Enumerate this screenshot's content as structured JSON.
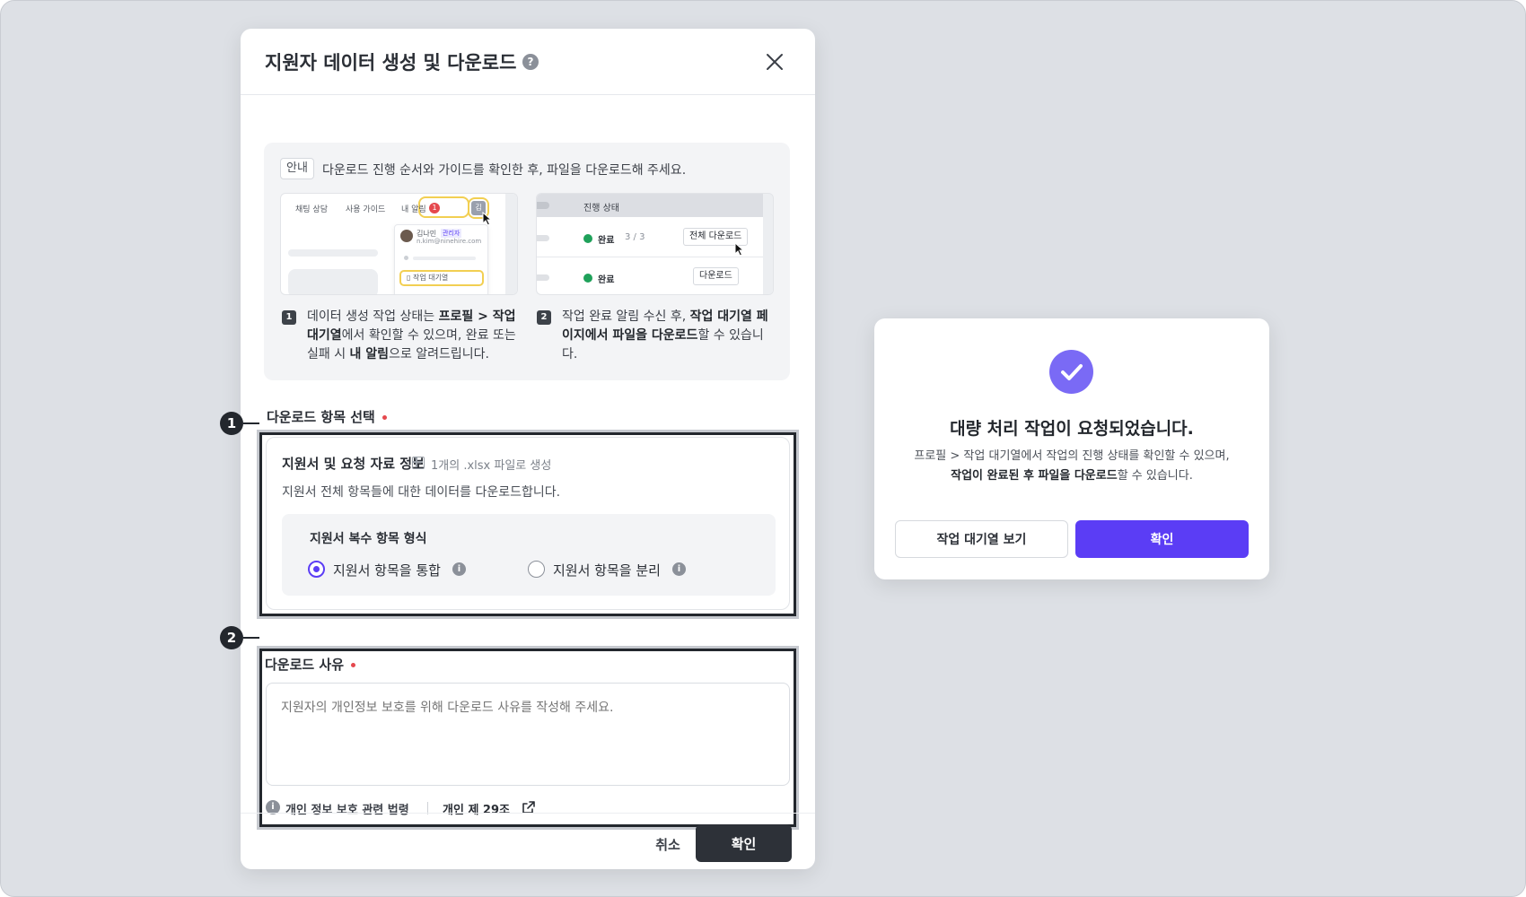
{
  "modal": {
    "title": "지원자 데이터 생성 및 다운로드",
    "help_icon": "?",
    "guide": {
      "badge": "안내",
      "text": "다운로드 진행 순서와 가이드를 확인한 후, 파일을 다운로드해 주세요.",
      "shot1": {
        "nav_items": [
          "채팅 상담",
          "사용 가이드",
          "내 알림"
        ],
        "notif_count": "1",
        "avatar_initial": "김",
        "user_name": "김나민",
        "user_role": "관리자",
        "user_email": "n.kim@ninehire.com",
        "menu_item": "작업 대기열"
      },
      "shot2": {
        "header": "진행 상태",
        "row1_status": "완료",
        "row1_count": "3 / 3",
        "row1_button": "전체 다운로드",
        "row2_status": "완료",
        "row2_button": "다운로드"
      },
      "steps": [
        {
          "num": "1",
          "parts": [
            "데이터 생성 작업 상태는 ",
            "프로필 > 작업 대기열",
            "에서 확인할 수 있으며, 완료 또는 실패 시 ",
            "내 알림",
            "으로 알려드립니다."
          ]
        },
        {
          "num": "2",
          "parts": [
            "작업 완료 알림 수신 후, ",
            "작업 대기열 페이지에서 파일을 다운로드",
            "할 수 있습니다."
          ]
        }
      ]
    },
    "download_items": {
      "section_title": "다운로드 항목 선택",
      "card_title": "지원서 및 요청 자료 정보",
      "card_meta": "1개의 .xlsx 파일로 생성",
      "card_desc": "지원서 전체 항목들에 대한 데이터를 다운로드합니다.",
      "format_title": "지원서 복수 항목 형식",
      "options": [
        {
          "label": "지원서 항목을 통합",
          "checked": true
        },
        {
          "label": "지원서 항목을 분리",
          "checked": false
        }
      ],
      "info_icon": "i"
    },
    "reason": {
      "section_title": "다운로드 사유",
      "placeholder": "지원자의 개인정보 보호를 위해 다운로드 사유를 작성해 주세요.",
      "law_label": "개인 정보 보호 관련 법령",
      "law_link": "개인 제 29조"
    },
    "callouts": [
      "1",
      "2"
    ],
    "footer": {
      "cancel": "취소",
      "confirm": "확인"
    }
  },
  "dialog": {
    "title": "대량 처리 작업이 요청되었습니다.",
    "desc_line1": "프로필 > 작업 대기열에서 작업의 진행 상태를 확인할 수 있으며,",
    "desc_line2_bold": "작업이 완료된 후 파일을 다운로드",
    "desc_line2_rest": "할 수 있습니다.",
    "secondary_button": "작업 대기열 보기",
    "primary_button": "확인"
  },
  "colors": {
    "accent": "#5b3df5",
    "check_circle": "#7a6af5",
    "required_dot": "#e5484d",
    "dark_button": "#2d3138",
    "status_done": "#1fa15a",
    "highlight_yellow": "#f2cf52"
  }
}
